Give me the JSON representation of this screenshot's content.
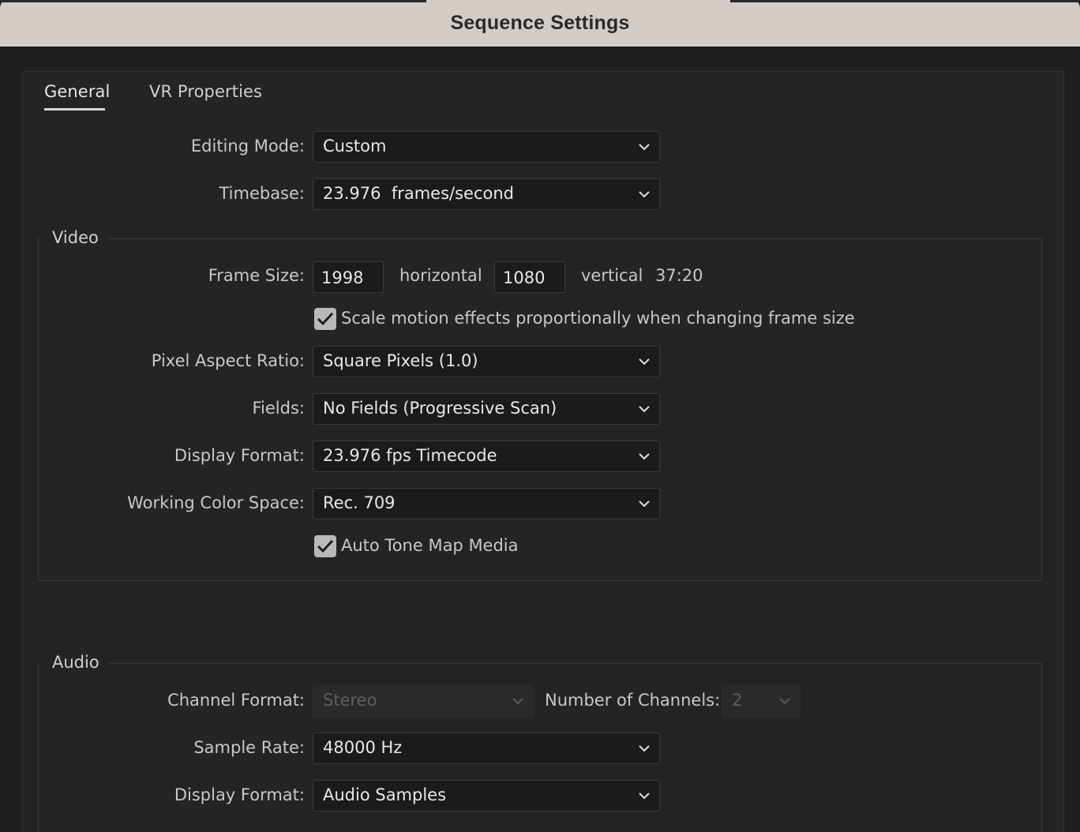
{
  "window": {
    "title": "Sequence Settings"
  },
  "tabs": [
    {
      "label": "General",
      "active": true
    },
    {
      "label": "VR Properties",
      "active": false
    }
  ],
  "general": {
    "editing_mode": {
      "label": "Editing Mode:",
      "value": "Custom"
    },
    "timebase": {
      "label": "Timebase:",
      "value": "23.976  frames/second"
    }
  },
  "video": {
    "title": "Video",
    "frame_size": {
      "label": "Frame Size:",
      "horizontal": "1998",
      "horizontal_label": "horizontal",
      "vertical": "1080",
      "vertical_label": "vertical",
      "aspect": "37:20"
    },
    "scale_motion": {
      "label": "Scale motion effects proportionally when changing frame size",
      "checked": true
    },
    "pixel_aspect_ratio": {
      "label": "Pixel Aspect Ratio:",
      "value": "Square Pixels (1.0)"
    },
    "fields": {
      "label": "Fields:",
      "value": "No Fields (Progressive Scan)"
    },
    "display_format": {
      "label": "Display Format:",
      "value": "23.976 fps Timecode"
    },
    "working_color_space": {
      "label": "Working Color Space:",
      "value": "Rec. 709"
    },
    "auto_tone_map": {
      "label": "Auto Tone Map Media",
      "checked": true
    }
  },
  "audio": {
    "title": "Audio",
    "channel_format": {
      "label": "Channel Format:",
      "value": "Stereo",
      "disabled": true
    },
    "number_of_channels": {
      "label": "Number of Channels:",
      "value": "2",
      "disabled": true
    },
    "sample_rate": {
      "label": "Sample Rate:",
      "value": "48000 Hz"
    },
    "display_format": {
      "label": "Display Format:",
      "value": "Audio Samples"
    }
  },
  "colors": {
    "background": "#1f1f1f",
    "titlebar": "#d3cbc6",
    "field_bg": "#1b1b1b",
    "checkbox": "#b9b9b9"
  },
  "icons": [
    "chevron-down-icon",
    "checkmark-icon"
  ]
}
